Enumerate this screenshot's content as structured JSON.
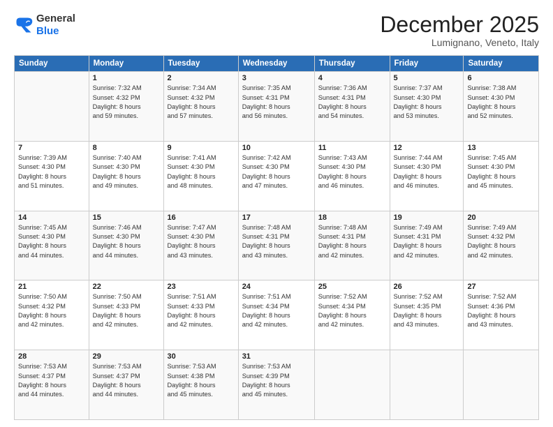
{
  "logo": {
    "general": "General",
    "blue": "Blue"
  },
  "header": {
    "month": "December 2025",
    "location": "Lumignano, Veneto, Italy"
  },
  "weekdays": [
    "Sunday",
    "Monday",
    "Tuesday",
    "Wednesday",
    "Thursday",
    "Friday",
    "Saturday"
  ],
  "weeks": [
    [
      {
        "day": "",
        "info": ""
      },
      {
        "day": "1",
        "info": "Sunrise: 7:32 AM\nSunset: 4:32 PM\nDaylight: 8 hours\nand 59 minutes."
      },
      {
        "day": "2",
        "info": "Sunrise: 7:34 AM\nSunset: 4:32 PM\nDaylight: 8 hours\nand 57 minutes."
      },
      {
        "day": "3",
        "info": "Sunrise: 7:35 AM\nSunset: 4:31 PM\nDaylight: 8 hours\nand 56 minutes."
      },
      {
        "day": "4",
        "info": "Sunrise: 7:36 AM\nSunset: 4:31 PM\nDaylight: 8 hours\nand 54 minutes."
      },
      {
        "day": "5",
        "info": "Sunrise: 7:37 AM\nSunset: 4:30 PM\nDaylight: 8 hours\nand 53 minutes."
      },
      {
        "day": "6",
        "info": "Sunrise: 7:38 AM\nSunset: 4:30 PM\nDaylight: 8 hours\nand 52 minutes."
      }
    ],
    [
      {
        "day": "7",
        "info": "Sunrise: 7:39 AM\nSunset: 4:30 PM\nDaylight: 8 hours\nand 51 minutes."
      },
      {
        "day": "8",
        "info": "Sunrise: 7:40 AM\nSunset: 4:30 PM\nDaylight: 8 hours\nand 49 minutes."
      },
      {
        "day": "9",
        "info": "Sunrise: 7:41 AM\nSunset: 4:30 PM\nDaylight: 8 hours\nand 48 minutes."
      },
      {
        "day": "10",
        "info": "Sunrise: 7:42 AM\nSunset: 4:30 PM\nDaylight: 8 hours\nand 47 minutes."
      },
      {
        "day": "11",
        "info": "Sunrise: 7:43 AM\nSunset: 4:30 PM\nDaylight: 8 hours\nand 46 minutes."
      },
      {
        "day": "12",
        "info": "Sunrise: 7:44 AM\nSunset: 4:30 PM\nDaylight: 8 hours\nand 46 minutes."
      },
      {
        "day": "13",
        "info": "Sunrise: 7:45 AM\nSunset: 4:30 PM\nDaylight: 8 hours\nand 45 minutes."
      }
    ],
    [
      {
        "day": "14",
        "info": "Sunrise: 7:45 AM\nSunset: 4:30 PM\nDaylight: 8 hours\nand 44 minutes."
      },
      {
        "day": "15",
        "info": "Sunrise: 7:46 AM\nSunset: 4:30 PM\nDaylight: 8 hours\nand 44 minutes."
      },
      {
        "day": "16",
        "info": "Sunrise: 7:47 AM\nSunset: 4:30 PM\nDaylight: 8 hours\nand 43 minutes."
      },
      {
        "day": "17",
        "info": "Sunrise: 7:48 AM\nSunset: 4:31 PM\nDaylight: 8 hours\nand 43 minutes."
      },
      {
        "day": "18",
        "info": "Sunrise: 7:48 AM\nSunset: 4:31 PM\nDaylight: 8 hours\nand 42 minutes."
      },
      {
        "day": "19",
        "info": "Sunrise: 7:49 AM\nSunset: 4:31 PM\nDaylight: 8 hours\nand 42 minutes."
      },
      {
        "day": "20",
        "info": "Sunrise: 7:49 AM\nSunset: 4:32 PM\nDaylight: 8 hours\nand 42 minutes."
      }
    ],
    [
      {
        "day": "21",
        "info": "Sunrise: 7:50 AM\nSunset: 4:32 PM\nDaylight: 8 hours\nand 42 minutes."
      },
      {
        "day": "22",
        "info": "Sunrise: 7:50 AM\nSunset: 4:33 PM\nDaylight: 8 hours\nand 42 minutes."
      },
      {
        "day": "23",
        "info": "Sunrise: 7:51 AM\nSunset: 4:33 PM\nDaylight: 8 hours\nand 42 minutes."
      },
      {
        "day": "24",
        "info": "Sunrise: 7:51 AM\nSunset: 4:34 PM\nDaylight: 8 hours\nand 42 minutes."
      },
      {
        "day": "25",
        "info": "Sunrise: 7:52 AM\nSunset: 4:34 PM\nDaylight: 8 hours\nand 42 minutes."
      },
      {
        "day": "26",
        "info": "Sunrise: 7:52 AM\nSunset: 4:35 PM\nDaylight: 8 hours\nand 43 minutes."
      },
      {
        "day": "27",
        "info": "Sunrise: 7:52 AM\nSunset: 4:36 PM\nDaylight: 8 hours\nand 43 minutes."
      }
    ],
    [
      {
        "day": "28",
        "info": "Sunrise: 7:53 AM\nSunset: 4:37 PM\nDaylight: 8 hours\nand 44 minutes."
      },
      {
        "day": "29",
        "info": "Sunrise: 7:53 AM\nSunset: 4:37 PM\nDaylight: 8 hours\nand 44 minutes."
      },
      {
        "day": "30",
        "info": "Sunrise: 7:53 AM\nSunset: 4:38 PM\nDaylight: 8 hours\nand 45 minutes."
      },
      {
        "day": "31",
        "info": "Sunrise: 7:53 AM\nSunset: 4:39 PM\nDaylight: 8 hours\nand 45 minutes."
      },
      {
        "day": "",
        "info": ""
      },
      {
        "day": "",
        "info": ""
      },
      {
        "day": "",
        "info": ""
      }
    ]
  ]
}
